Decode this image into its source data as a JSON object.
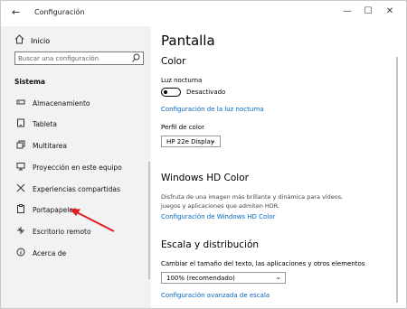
{
  "window": {
    "title": "Configuración",
    "back_glyph": "←",
    "minimize_glyph": "—",
    "maximize_glyph": "☐",
    "close_glyph": "✕"
  },
  "sidebar": {
    "home_label": "Inicio",
    "search_placeholder": "Buscar una configuración",
    "section_title": "Sistema",
    "items": [
      {
        "label": "Almacenamiento",
        "icon": "storage-icon"
      },
      {
        "label": "Tableta",
        "icon": "tablet-icon"
      },
      {
        "label": "Multitarea",
        "icon": "multitasking-icon"
      },
      {
        "label": "Proyección en este equipo",
        "icon": "projection-icon"
      },
      {
        "label": "Experiencias compartidas",
        "icon": "shared-experiences-icon"
      },
      {
        "label": "Portapapeles",
        "icon": "clipboard-icon"
      },
      {
        "label": "Escritorio remoto",
        "icon": "remote-desktop-icon"
      },
      {
        "label": "Acerca de",
        "icon": "info-icon"
      }
    ]
  },
  "main": {
    "title": "Pantalla",
    "color": {
      "heading": "Color",
      "night_light_label": "Luz nocturna",
      "night_light_state": "Desactivado",
      "night_light_link": "Configuración de la luz nocturna",
      "color_profile_label": "Perfil de color",
      "color_profile_value": "HP 22e Display"
    },
    "hd_color": {
      "heading": "Windows HD Color",
      "description": "Disfruta de una imagen más brillante y dinámica para vídeos, juegos y aplicaciones que admiten HDR.",
      "link": "Configuración de Windows HD Color"
    },
    "scale": {
      "heading": "Escala y distribución",
      "size_label": "Cambiar el tamaño del texto, las aplicaciones y otros elementos",
      "size_value": "100% (recomendado)",
      "advanced_link": "Configuración avanzada de escala"
    }
  },
  "colors": {
    "accent_link": "#0067c0",
    "sidebar_bg": "#f2f2f2",
    "annotation_arrow": "#e02020"
  }
}
